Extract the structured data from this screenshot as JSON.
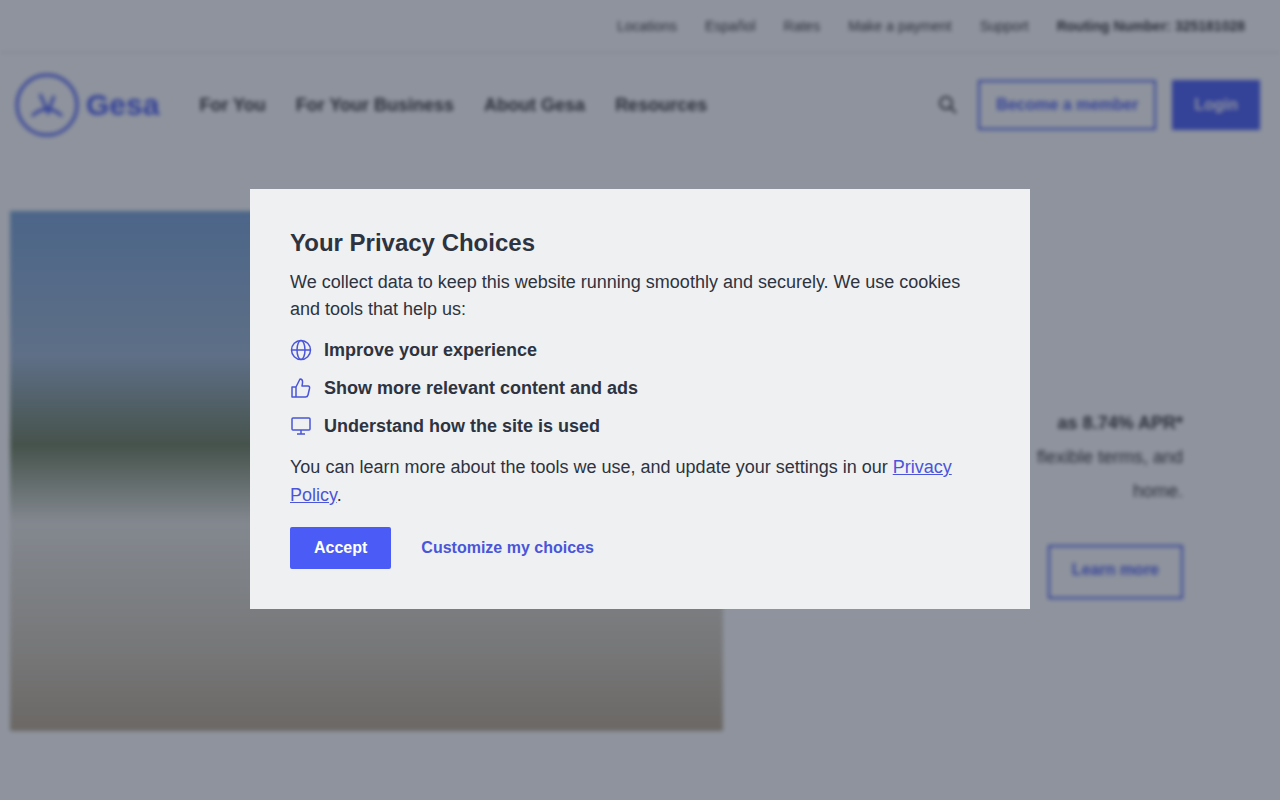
{
  "utility_links": [
    "Locations",
    "Español",
    "Rates",
    "Make a payment",
    "Support"
  ],
  "routing": "Routing Number: 325181028",
  "logo": "Gesa",
  "nav": [
    "For You",
    "For Your Business",
    "About Gesa",
    "Resources"
  ],
  "actions": {
    "member": "Become a member",
    "login": "Login"
  },
  "hero": {
    "rate": "as 8.74% APR*",
    "terms": "flexible terms, and",
    "end": "home.",
    "button": "Learn more"
  },
  "dialog": {
    "title": "Your Privacy Choices",
    "intro": "We collect data to keep this website running smoothly and securely. We use cookies and tools that help us:",
    "items": [
      {
        "label": "Improve your experience"
      },
      {
        "label": "Show more relevant content and ads"
      },
      {
        "label": "Understand how the site is used"
      }
    ],
    "policy_prefix": "You can learn more about the tools we use, and update your settings in our",
    "policy_link": "Privacy Policy",
    "policy_suffix": ".",
    "accept": "Accept",
    "customize": "Customize my choices"
  }
}
